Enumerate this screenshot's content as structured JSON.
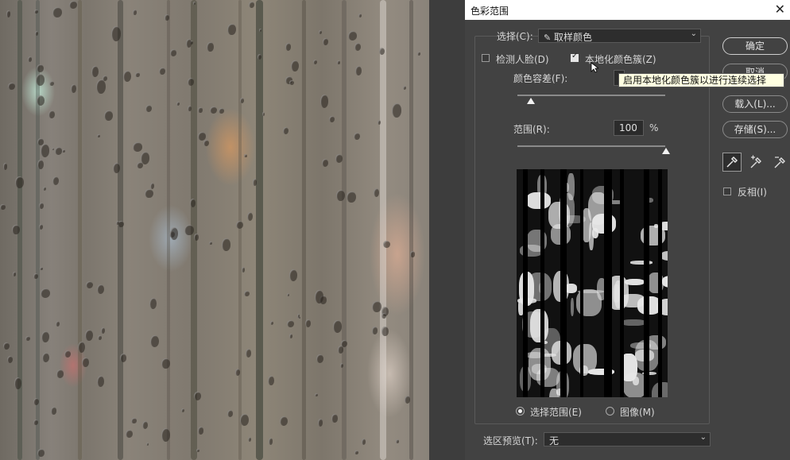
{
  "dialog": {
    "title": "色彩范围",
    "select_label": "选择(C):",
    "select_value": "取样颜色",
    "detect_faces_label": "检测人脸(D)",
    "detect_faces_checked": false,
    "localized_label": "本地化颜色簇(Z)",
    "localized_checked": true,
    "tolerance_label": "颜色容差(F):",
    "tolerance_value": "",
    "range_label": "范围(R):",
    "range_value": "100",
    "range_unit": "%",
    "range_level": 1.0,
    "preview_options": {
      "selection_label": "选择范围(E)",
      "image_label": "图像(M)",
      "selected": "selection"
    },
    "preview_mode_label": "选区预览(T):",
    "preview_mode_value": "无",
    "invert_label": "反相(I)",
    "invert_checked": false,
    "tooltip": "启用本地化颜色簇以进行连续选择"
  },
  "buttons": {
    "ok": "确定",
    "cancel": "取消",
    "load": "载入(L)...",
    "save": "存储(S)..."
  },
  "tools": [
    "eyedropper-icon",
    "eyedropper-plus-icon",
    "eyedropper-minus-icon"
  ],
  "colors": {
    "dialog_bg": "#424242",
    "tooltip_bg": "#ffffe1"
  }
}
